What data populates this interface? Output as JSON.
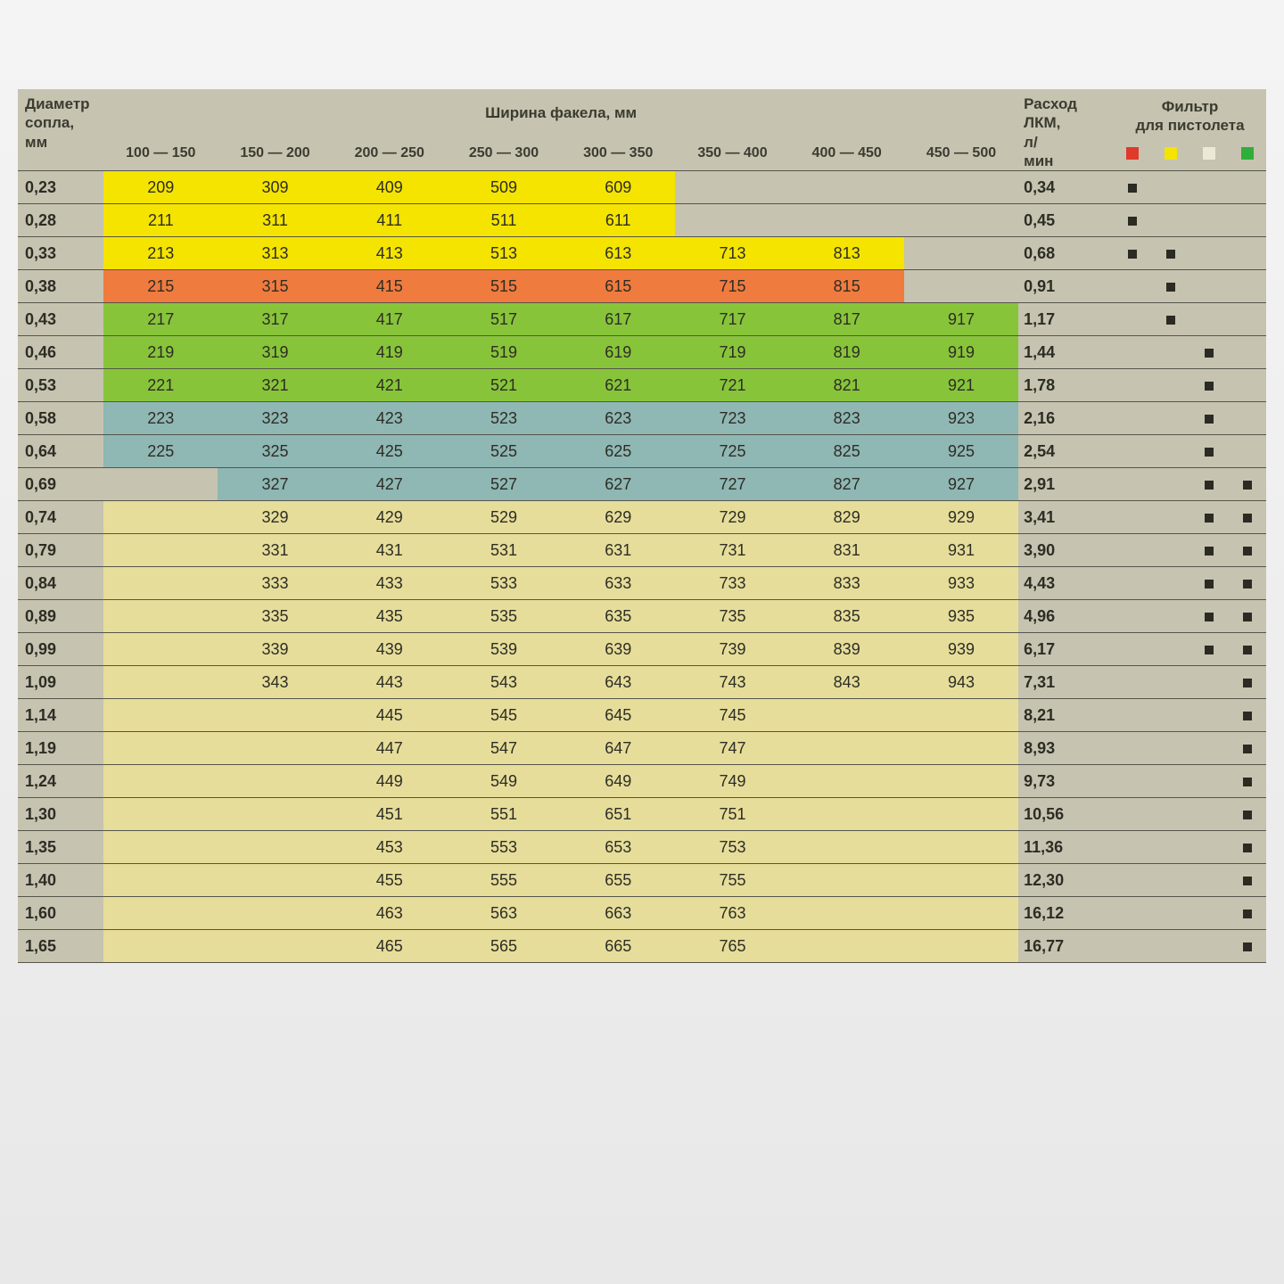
{
  "headers": {
    "diameter": "Диаметр сопла, мм",
    "fan_width": "Ширина факела, мм",
    "flow": "Расход ЛКМ, л/мин",
    "filter": "Фильтр для пистолета",
    "ranges": [
      "100 — 150",
      "150 — 200",
      "200 — 250",
      "250 — 300",
      "300 — 350",
      "350 — 400",
      "400 — 450",
      "450 — 500"
    ]
  },
  "filter_colors": [
    "red",
    "yellow",
    "white",
    "green"
  ],
  "rows": [
    {
      "d": "0,23",
      "bg": "yellow",
      "v": [
        "209",
        "309",
        "409",
        "509",
        "609",
        "",
        "",
        ""
      ],
      "f": "0,34",
      "m": [
        1,
        0,
        0,
        0
      ]
    },
    {
      "d": "0,28",
      "bg": "yellow",
      "v": [
        "211",
        "311",
        "411",
        "511",
        "611",
        "",
        "",
        ""
      ],
      "f": "0,45",
      "m": [
        1,
        0,
        0,
        0
      ]
    },
    {
      "d": "0,33",
      "bg": "yellow",
      "v": [
        "213",
        "313",
        "413",
        "513",
        "613",
        "713",
        "813",
        ""
      ],
      "f": "0,68",
      "m": [
        1,
        1,
        0,
        0
      ]
    },
    {
      "d": "0,38",
      "bg": "orange",
      "v": [
        "215",
        "315",
        "415",
        "515",
        "615",
        "715",
        "815",
        ""
      ],
      "f": "0,91",
      "m": [
        0,
        1,
        0,
        0
      ]
    },
    {
      "d": "0,43",
      "bg": "green",
      "v": [
        "217",
        "317",
        "417",
        "517",
        "617",
        "717",
        "817",
        "917"
      ],
      "f": "1,17",
      "m": [
        0,
        1,
        0,
        0
      ]
    },
    {
      "d": "0,46",
      "bg": "green",
      "v": [
        "219",
        "319",
        "419",
        "519",
        "619",
        "719",
        "819",
        "919"
      ],
      "f": "1,44",
      "m": [
        0,
        0,
        1,
        0
      ]
    },
    {
      "d": "0,53",
      "bg": "green",
      "v": [
        "221",
        "321",
        "421",
        "521",
        "621",
        "721",
        "821",
        "921"
      ],
      "f": "1,78",
      "m": [
        0,
        0,
        1,
        0
      ]
    },
    {
      "d": "0,58",
      "bg": "teal",
      "v": [
        "223",
        "323",
        "423",
        "523",
        "623",
        "723",
        "823",
        "923"
      ],
      "f": "2,16",
      "m": [
        0,
        0,
        1,
        0
      ]
    },
    {
      "d": "0,64",
      "bg": "teal",
      "v": [
        "225",
        "325",
        "425",
        "525",
        "625",
        "725",
        "825",
        "925"
      ],
      "f": "2,54",
      "m": [
        0,
        0,
        1,
        0
      ]
    },
    {
      "d": "0,69",
      "bg": "teal",
      "v": [
        "",
        "327",
        "427",
        "527",
        "627",
        "727",
        "827",
        "927"
      ],
      "f": "2,91",
      "m": [
        0,
        0,
        1,
        1
      ]
    },
    {
      "d": "0,74",
      "bg": "sand",
      "v": [
        "",
        "329",
        "429",
        "529",
        "629",
        "729",
        "829",
        "929"
      ],
      "f": "3,41",
      "m": [
        0,
        0,
        1,
        1
      ]
    },
    {
      "d": "0,79",
      "bg": "sand",
      "v": [
        "",
        "331",
        "431",
        "531",
        "631",
        "731",
        "831",
        "931"
      ],
      "f": "3,90",
      "m": [
        0,
        0,
        1,
        1
      ]
    },
    {
      "d": "0,84",
      "bg": "sand",
      "v": [
        "",
        "333",
        "433",
        "533",
        "633",
        "733",
        "833",
        "933"
      ],
      "f": "4,43",
      "m": [
        0,
        0,
        1,
        1
      ]
    },
    {
      "d": "0,89",
      "bg": "sand",
      "v": [
        "",
        "335",
        "435",
        "535",
        "635",
        "735",
        "835",
        "935"
      ],
      "f": "4,96",
      "m": [
        0,
        0,
        1,
        1
      ]
    },
    {
      "d": "0,99",
      "bg": "sand",
      "v": [
        "",
        "339",
        "439",
        "539",
        "639",
        "739",
        "839",
        "939"
      ],
      "f": "6,17",
      "m": [
        0,
        0,
        1,
        1
      ]
    },
    {
      "d": "1,09",
      "bg": "sand",
      "v": [
        "",
        "343",
        "443",
        "543",
        "643",
        "743",
        "843",
        "943"
      ],
      "f": "7,31",
      "m": [
        0,
        0,
        0,
        1
      ]
    },
    {
      "d": "1,14",
      "bg": "sand",
      "v": [
        "",
        "",
        "445",
        "545",
        "645",
        "745",
        "",
        ""
      ],
      "f": "8,21",
      "m": [
        0,
        0,
        0,
        1
      ]
    },
    {
      "d": "1,19",
      "bg": "sand",
      "v": [
        "",
        "",
        "447",
        "547",
        "647",
        "747",
        "",
        ""
      ],
      "f": "8,93",
      "m": [
        0,
        0,
        0,
        1
      ]
    },
    {
      "d": "1,24",
      "bg": "sand",
      "v": [
        "",
        "",
        "449",
        "549",
        "649",
        "749",
        "",
        ""
      ],
      "f": "9,73",
      "m": [
        0,
        0,
        0,
        1
      ]
    },
    {
      "d": "1,30",
      "bg": "sand",
      "v": [
        "",
        "",
        "451",
        "551",
        "651",
        "751",
        "",
        ""
      ],
      "f": "10,56",
      "m": [
        0,
        0,
        0,
        1
      ]
    },
    {
      "d": "1,35",
      "bg": "sand",
      "v": [
        "",
        "",
        "453",
        "553",
        "653",
        "753",
        "",
        ""
      ],
      "f": "11,36",
      "m": [
        0,
        0,
        0,
        1
      ]
    },
    {
      "d": "1,40",
      "bg": "sand",
      "v": [
        "",
        "",
        "455",
        "555",
        "655",
        "755",
        "",
        ""
      ],
      "f": "12,30",
      "m": [
        0,
        0,
        0,
        1
      ]
    },
    {
      "d": "1,60",
      "bg": "sand",
      "v": [
        "",
        "",
        "463",
        "563",
        "663",
        "763",
        "",
        ""
      ],
      "f": "16,12",
      "m": [
        0,
        0,
        0,
        1
      ]
    },
    {
      "d": "1,65",
      "bg": "sand",
      "v": [
        "",
        "",
        "465",
        "565",
        "665",
        "765",
        "",
        ""
      ],
      "f": "16,77",
      "m": [
        0,
        0,
        0,
        1
      ]
    }
  ]
}
